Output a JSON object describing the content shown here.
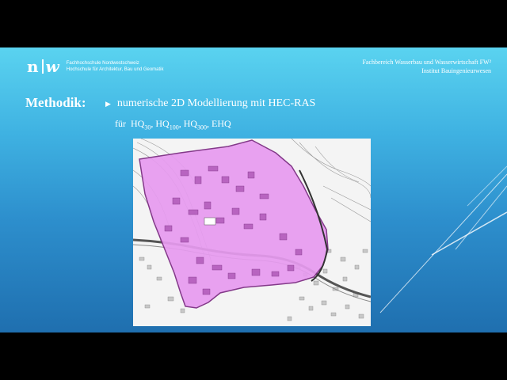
{
  "header": {
    "logo_mark_left": "n",
    "logo_mark_right": "w",
    "school_line1": "Fachhochschule Nordwestschweiz",
    "school_line2": "Hochschule für Architektur, Bau und Geomatik",
    "dept_line1": "Fachbereich Wasserbau und Wasserwirtschaft FW²",
    "dept_line2": "Institut Bauingenieurwesen"
  },
  "content": {
    "heading": "Methodik:",
    "bullet": "numerische 2D Modellierung mit HEC-RAS",
    "hq_prefix": "für",
    "hq_items": [
      {
        "base": "HQ",
        "sub": "30",
        "sep": ","
      },
      {
        "base": "HQ",
        "sub": "100",
        "sep": ","
      },
      {
        "base": "HQ",
        "sub": "300",
        "sep": ","
      },
      {
        "base": "EHQ",
        "sub": "",
        "sep": ""
      }
    ]
  },
  "colors": {
    "flood_fill": "#e79bf0",
    "flood_outline": "#7a2a80",
    "bg_top": "#5ad3f0",
    "bg_bottom": "#1f6faf"
  }
}
